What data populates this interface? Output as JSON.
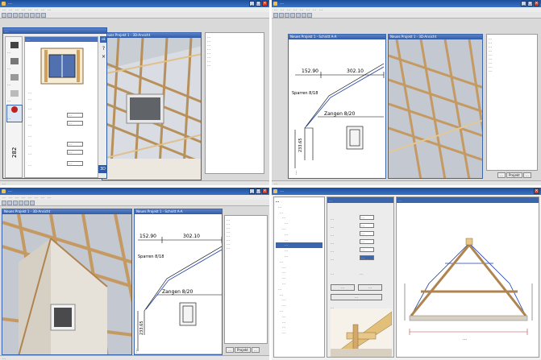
{
  "q1": {
    "title": "…",
    "menu": [
      "…",
      "…",
      "…",
      "…",
      "…",
      "…",
      "…",
      "…"
    ],
    "status": "…",
    "dialog_title": "…",
    "side_tabs": [
      "…",
      "…",
      "…",
      "…",
      "…"
    ],
    "section": "…",
    "options": [
      "…",
      "…"
    ],
    "labels": [
      "…",
      "…",
      "…",
      "…",
      "…",
      "…",
      "…"
    ],
    "values": [
      "…",
      "…",
      "…",
      "…",
      "…"
    ],
    "ok": "ok",
    "view3d": "3D",
    "subwin_title": "Neues Projekt 1 - 3D-Ansicht",
    "tree": [
      "…",
      "…",
      "…",
      "…",
      "…",
      "…",
      "…",
      "…"
    ],
    "dim_vertical": "282"
  },
  "q2": {
    "title": "…",
    "menu": [
      "…",
      "…",
      "…",
      "…",
      "…",
      "…",
      "…",
      "…"
    ],
    "status": "…",
    "sub1_title": "Neues Projekt 1 - Schnitt A-A",
    "sub2_title": "Neues Projekt 1 - 3D-Ansicht",
    "dim_top_left": "152.90",
    "dim_top_right": "302.10",
    "label_sparren": "Sparren 8/18",
    "label_zangen": "Zangen 8/20",
    "dim_v1": "233.65",
    "dim_v2": "…",
    "tree": [
      "…",
      "…",
      "…",
      "…",
      "…",
      "…",
      "…",
      "…",
      "…"
    ],
    "tabs": [
      "…",
      "Projekt",
      "…"
    ]
  },
  "q3": {
    "title": "…",
    "menu": [
      "…",
      "…",
      "…",
      "…",
      "…",
      "…",
      "…",
      "…"
    ],
    "status": "…",
    "sub1_title": "Neues Projekt 1 - 3D-Ansicht",
    "sub2_title": "Neues Projekt 1 - Schnitt A-A",
    "dim_top_left": "152.90",
    "dim_top_right": "302.10",
    "label_sparren": "Sparren 8/18",
    "label_zangen": "Zangen 8/20",
    "dim_v1": "233.65",
    "dim_v2": "…",
    "tree": [
      "…",
      "…",
      "…",
      "…",
      "…",
      "…",
      "…",
      "…"
    ],
    "tabs": [
      "…",
      "Projekt",
      "…"
    ]
  },
  "q4": {
    "title": "…",
    "tree_root": "…",
    "tree": [
      "…",
      "…",
      "…",
      "…",
      "…",
      "…",
      "…",
      "…",
      "…",
      "…",
      "…",
      "…",
      "…",
      "…",
      "…",
      "…",
      "…",
      "…",
      "…",
      "…",
      "…",
      "…",
      "…"
    ],
    "tree_selected": "…",
    "form_header": "…",
    "form_labels": [
      "…",
      "…",
      "…",
      "…",
      "…",
      "…"
    ],
    "form_values": [
      "…",
      "…",
      "…",
      "…",
      "…",
      "…"
    ],
    "radio": [
      "…",
      "…"
    ],
    "buttons": [
      "…",
      "…",
      "…"
    ],
    "preview_title": "…",
    "section_title": "…",
    "dim_bottom": "…"
  },
  "colors": {
    "titlebar": "#2a5fb0",
    "timber": "#d8b47a",
    "timber_dark": "#a07840",
    "sky": "#c8ccd4",
    "window_pane": "#3a3a3a",
    "drawing_blue": "#1a3ea8"
  }
}
